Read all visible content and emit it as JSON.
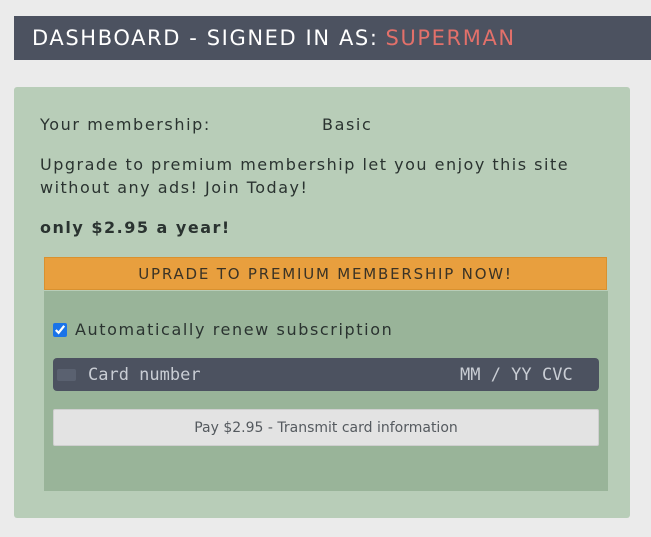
{
  "header": {
    "prefix": "DASHBOARD - SIGNED IN AS:",
    "username": "SUPERMAN"
  },
  "membership": {
    "label": "Your membership:",
    "value": "Basic"
  },
  "promo": {
    "text": "Upgrade to premium membership let you enjoy this site without any ads! Join Today!",
    "price": "only $2.95 a year!",
    "upgrade_label": "UPRADE TO PREMIUM MEMBERSHIP NOW!"
  },
  "payment": {
    "auto_renew_label": "Automatically renew subscription",
    "auto_renew_checked": true,
    "card_placeholder": "Card number",
    "expiry_placeholder": "MM / YY",
    "cvc_placeholder": "CVC",
    "pay_label": "Pay $2.95 - Transmit card information"
  },
  "colors": {
    "header_bg": "#4c5260",
    "username": "#e2706a",
    "panel_bg": "#b8cdb8",
    "subpanel_bg": "#99b499",
    "upgrade_button": "#e89f3e"
  },
  "icons": {
    "card": "credit-card-icon"
  }
}
